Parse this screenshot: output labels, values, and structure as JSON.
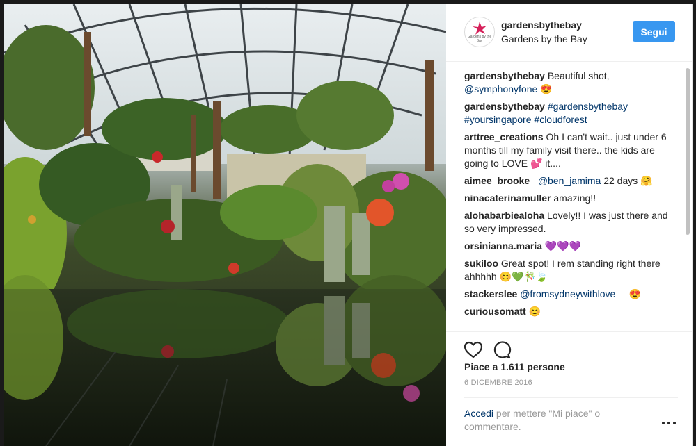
{
  "header": {
    "handle": "gardensbythebay",
    "full_name": "Gardens by the Bay",
    "follow_label": "Segui",
    "avatar_text": "Gardens by the Bay"
  },
  "comments": [
    {
      "user": "gardensbythebay",
      "parts": [
        {
          "t": "text",
          "v": " Beautiful shot, "
        },
        {
          "t": "tag",
          "v": "@symphonyfone"
        },
        {
          "t": "text",
          "v": " 😍"
        }
      ]
    },
    {
      "user": "gardensbythebay",
      "parts": [
        {
          "t": "text",
          "v": " "
        },
        {
          "t": "tag",
          "v": "#gardensbythebay"
        },
        {
          "t": "text",
          "v": " "
        },
        {
          "t": "tag",
          "v": "#yoursingapore"
        },
        {
          "t": "text",
          "v": " "
        },
        {
          "t": "tag",
          "v": "#cloudforest"
        }
      ]
    },
    {
      "user": "arttree_creations",
      "parts": [
        {
          "t": "text",
          "v": " Oh I can't wait.. just under 6 months till my family visit there.. the kids are going to LOVE 💕 it...."
        }
      ]
    },
    {
      "user": "aimee_brooke_",
      "parts": [
        {
          "t": "text",
          "v": " "
        },
        {
          "t": "tag",
          "v": "@ben_jamima"
        },
        {
          "t": "text",
          "v": " 22 days 🤗"
        }
      ]
    },
    {
      "user": "ninacaterinamuller",
      "parts": [
        {
          "t": "text",
          "v": " amazing!!"
        }
      ]
    },
    {
      "user": "alohabarbiealoha",
      "parts": [
        {
          "t": "text",
          "v": " Lovely!! I was just there and so very impressed."
        }
      ]
    },
    {
      "user": "orsinianna.maria",
      "parts": [
        {
          "t": "text",
          "v": " 💜💜💜"
        }
      ]
    },
    {
      "user": "sukiloo",
      "parts": [
        {
          "t": "text",
          "v": " Great spot! I rem standing right there ahhhhh 😊💚🎋🍃"
        }
      ]
    },
    {
      "user": "stackerslee",
      "parts": [
        {
          "t": "text",
          "v": " "
        },
        {
          "t": "tag",
          "v": "@fromsydneywithlove__"
        },
        {
          "t": "text",
          "v": " 😍"
        }
      ]
    },
    {
      "user": "curiousomatt",
      "parts": [
        {
          "t": "text",
          "v": " 😊"
        }
      ]
    }
  ],
  "actions": {
    "like_icon": "heart-icon",
    "comment_icon": "speech-bubble-icon",
    "likes_text": "Piace a 1.611 persone",
    "date": "6 DICEMBRE 2016",
    "login_link": "Accedi",
    "login_rest": " per mettere \"Mi piace\" o commentare.",
    "more_icon": "more-options-icon"
  },
  "colors": {
    "follow_button": "#3897f0",
    "link": "#003569",
    "muted": "#999999",
    "text": "#262626"
  }
}
